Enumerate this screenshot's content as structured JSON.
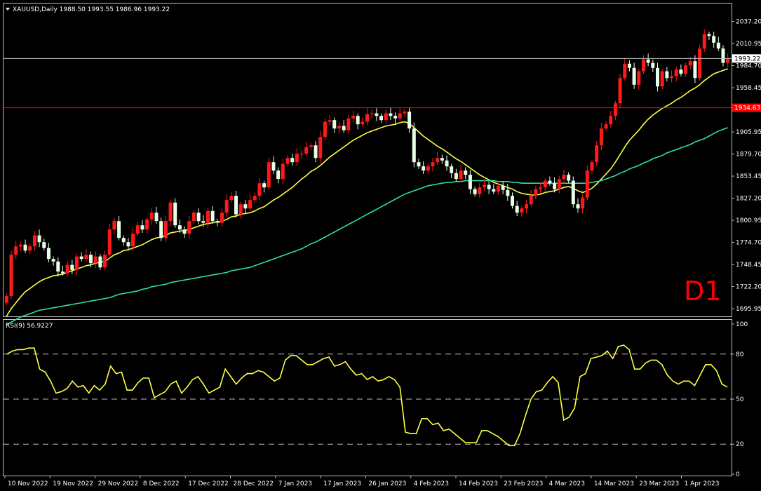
{
  "window": {
    "symbol_line": "XAUUSD,Daily  1988.50 1993.55 1986.96 1993.22",
    "timeframe_watermark": "D1",
    "menu_arrow": "triangle-down-icon"
  },
  "colors": {
    "background": "#000000",
    "grid_frame": "#c0c0c0",
    "bull_candle": "#ff1a1a",
    "bear_candle": "#e8ffe8",
    "ma_fast": "#ffff40",
    "ma_slow": "#30e0a0",
    "rsi_line": "#ffff40",
    "price_line": "#c0c0c0",
    "h_line": "#ff0000",
    "watermark": "#ff0000"
  },
  "chart_data": [
    {
      "type": "candlestick",
      "title": "XAUUSD,Daily",
      "ohlc_last": {
        "open": 1988.5,
        "high": 1993.55,
        "low": 1986.96,
        "close": 1993.22
      },
      "ylim": [
        1688.5,
        2046.0
      ],
      "y_ticks": [
        "2037.20",
        "2010.95",
        "1984.70",
        "1958.45",
        "1932.20",
        "1905.95",
        "1879.70",
        "1853.45",
        "1827.20",
        "1800.95",
        "1774.70",
        "1748.45",
        "1722.20",
        "1695.95"
      ],
      "x_ticks": [
        "10 Nov 2022",
        "19 Nov 2022",
        "29 Nov 2022",
        "8 Dec 2022",
        "17 Dec 2022",
        "28 Dec 2022",
        "7 Jan 2023",
        "17 Jan 2023",
        "26 Jan 2023",
        "4 Feb 2023",
        "14 Feb 2023",
        "23 Feb 2023",
        "4 Mar 2023",
        "14 Mar 2023",
        "23 Mar 2023",
        "1 Apr 2023"
      ],
      "current_price_label": "1993.22",
      "horizontal_line_label": "1934.63",
      "closes": [
        1711,
        1760,
        1770,
        1772,
        1765,
        1770,
        1783,
        1775,
        1768,
        1755,
        1752,
        1740,
        1738,
        1748,
        1742,
        1758,
        1755,
        1760,
        1750,
        1758,
        1745,
        1760,
        1790,
        1800,
        1780,
        1775,
        1770,
        1785,
        1795,
        1790,
        1802,
        1810,
        1800,
        1780,
        1800,
        1822,
        1795,
        1790,
        1785,
        1800,
        1810,
        1800,
        1798,
        1812,
        1800,
        1798,
        1810,
        1825,
        1830,
        1808,
        1820,
        1815,
        1825,
        1830,
        1845,
        1840,
        1870,
        1860,
        1850,
        1868,
        1875,
        1870,
        1880,
        1880,
        1888,
        1890,
        1875,
        1900,
        1918,
        1920,
        1910,
        1913,
        1908,
        1922,
        1925,
        1915,
        1918,
        1927,
        1928,
        1925,
        1920,
        1928,
        1925,
        1922,
        1928,
        1930,
        1910,
        1870,
        1865,
        1860,
        1865,
        1870,
        1875,
        1872,
        1865,
        1857,
        1850,
        1860,
        1855,
        1838,
        1832,
        1840,
        1843,
        1838,
        1835,
        1842,
        1837,
        1830,
        1818,
        1810,
        1815,
        1820,
        1830,
        1838,
        1840,
        1848,
        1845,
        1838,
        1850,
        1855,
        1848,
        1820,
        1815,
        1828,
        1860,
        1870,
        1890,
        1910,
        1915,
        1925,
        1940,
        1970,
        1987,
        1982,
        1962,
        1978,
        1992,
        1988,
        1982,
        1960,
        1978,
        1970,
        1972,
        1980,
        1975,
        1985,
        1990,
        1970,
        2005,
        2022,
        2020,
        2012,
        2005,
        1988,
        1993
      ],
      "series": [
        {
          "name": "MA fast",
          "values": [
            1687,
            1696,
            1703,
            1710,
            1716,
            1720,
            1724,
            1728,
            1731,
            1733,
            1735,
            1736,
            1737,
            1739,
            1741,
            1743,
            1745,
            1747,
            1748,
            1750,
            1751,
            1752,
            1756,
            1760,
            1762,
            1765,
            1766,
            1768,
            1770,
            1772,
            1775,
            1778,
            1780,
            1781,
            1783,
            1786,
            1787,
            1788,
            1789,
            1790,
            1792,
            1794,
            1796,
            1797,
            1798,
            1799,
            1800,
            1802,
            1805,
            1806,
            1808,
            1809,
            1810,
            1812,
            1815,
            1817,
            1821,
            1825,
            1828,
            1832,
            1836,
            1840,
            1845,
            1850,
            1854,
            1859,
            1862,
            1866,
            1871,
            1876,
            1880,
            1884,
            1888,
            1892,
            1896,
            1899,
            1902,
            1905,
            1907,
            1909,
            1911,
            1913,
            1914,
            1915,
            1917,
            1918,
            1916,
            1911,
            1906,
            1901,
            1897,
            1893,
            1889,
            1886,
            1882,
            1878,
            1874,
            1871,
            1867,
            1863,
            1859,
            1855,
            1852,
            1849,
            1846,
            1844,
            1842,
            1840,
            1838,
            1835,
            1833,
            1832,
            1831,
            1831,
            1832,
            1834,
            1835,
            1836,
            1838,
            1840,
            1841,
            1839,
            1836,
            1834,
            1836,
            1839,
            1844,
            1850,
            1856,
            1862,
            1870,
            1879,
            1888,
            1896,
            1902,
            1908,
            1915,
            1921,
            1926,
            1930,
            1934,
            1937,
            1940,
            1944,
            1947,
            1951,
            1955,
            1958,
            1962,
            1967,
            1971,
            1975,
            1977,
            1979,
            1981
          ]
        },
        {
          "name": "MA slow",
          "values": [
            1677,
            1680,
            1683,
            1686,
            1688,
            1690,
            1692,
            1694,
            1695,
            1696,
            1697,
            1698,
            1699,
            1700,
            1701,
            1702,
            1703,
            1704,
            1705,
            1706,
            1707,
            1708,
            1709,
            1711,
            1713,
            1714,
            1715,
            1716,
            1717,
            1719,
            1720,
            1722,
            1723,
            1724,
            1725,
            1727,
            1728,
            1729,
            1730,
            1731,
            1732,
            1733,
            1734,
            1735,
            1736,
            1737,
            1738,
            1739,
            1741,
            1742,
            1743,
            1744,
            1745,
            1747,
            1749,
            1751,
            1753,
            1755,
            1757,
            1759,
            1761,
            1763,
            1765,
            1767,
            1770,
            1773,
            1775,
            1778,
            1781,
            1784,
            1787,
            1790,
            1793,
            1796,
            1799,
            1802,
            1805,
            1808,
            1811,
            1814,
            1817,
            1820,
            1823,
            1826,
            1829,
            1832,
            1834,
            1836,
            1838,
            1840,
            1842,
            1843,
            1844,
            1845,
            1846,
            1846,
            1847,
            1847,
            1848,
            1848,
            1848,
            1848,
            1848,
            1848,
            1848,
            1847,
            1847,
            1847,
            1846,
            1846,
            1845,
            1845,
            1845,
            1845,
            1845,
            1845,
            1845,
            1845,
            1845,
            1845,
            1845,
            1845,
            1845,
            1845,
            1845,
            1846,
            1847,
            1848,
            1850,
            1852,
            1854,
            1857,
            1859,
            1862,
            1864,
            1866,
            1869,
            1871,
            1874,
            1876,
            1878,
            1881,
            1883,
            1885,
            1887,
            1889,
            1891,
            1894,
            1896,
            1898,
            1901,
            1904,
            1907,
            1909,
            1911
          ]
        }
      ]
    },
    {
      "type": "line",
      "title": "RSI(9) 56.9227",
      "ylim": [
        0,
        100
      ],
      "y_ticks": [
        "100",
        "80",
        "50",
        "20",
        "0"
      ],
      "levels": [
        80,
        50,
        20
      ],
      "series": [
        {
          "name": "RSI(9)",
          "values": [
            80,
            82,
            83,
            83,
            84,
            84,
            70,
            68,
            62,
            54,
            55,
            57,
            62,
            58,
            59,
            54,
            59,
            56,
            60,
            72,
            67,
            68,
            56,
            56,
            61,
            64,
            64,
            51,
            53,
            55,
            60,
            62,
            54,
            58,
            63,
            65,
            60,
            54,
            56,
            58,
            70,
            65,
            60,
            64,
            67,
            67,
            69,
            68,
            65,
            62,
            64,
            76,
            79,
            79,
            76,
            73,
            73,
            75,
            77,
            78,
            72,
            73,
            75,
            70,
            66,
            67,
            63,
            65,
            62,
            63,
            65,
            63,
            58,
            28,
            27,
            27,
            37,
            37,
            33,
            34,
            29,
            30,
            27,
            24,
            21,
            21,
            21,
            29,
            29,
            27,
            25,
            22,
            19,
            19,
            27,
            39,
            50,
            55,
            56,
            61,
            65,
            61,
            36,
            38,
            44,
            65,
            67,
            77,
            78,
            79,
            82,
            77,
            85,
            86,
            83,
            70,
            70,
            74,
            76,
            76,
            73,
            66,
            62,
            60,
            62,
            62,
            59,
            66,
            73,
            73,
            69,
            60,
            58
          ]
        }
      ]
    }
  ]
}
